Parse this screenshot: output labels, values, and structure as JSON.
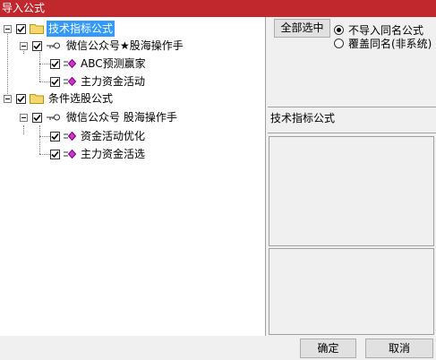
{
  "window": {
    "title": "导入公式"
  },
  "tree": {
    "groups": [
      {
        "label": "技术指标公式",
        "checked": true,
        "selected": true,
        "subgroup": {
          "label": "微信公众号★股海操作手",
          "checked": true,
          "items": [
            {
              "label": "ABC预测赢家",
              "checked": true
            },
            {
              "label": "主力资金活动",
              "checked": true
            }
          ]
        }
      },
      {
        "label": "条件选股公式",
        "checked": true,
        "selected": false,
        "subgroup": {
          "label": "微信公众号 股海操作手",
          "checked": true,
          "items": [
            {
              "label": "资金活动优化",
              "checked": true
            },
            {
              "label": "主力资金活选",
              "checked": true
            }
          ]
        }
      }
    ]
  },
  "options": {
    "select_all_label": "全部选中",
    "radio_skip_label": "不导入同名公式",
    "radio_overwrite_label": "覆盖同名(非系统)",
    "selected_radio": "skip"
  },
  "info": {
    "type_label": "技术指标公式"
  },
  "buttons": {
    "ok_label": "确定",
    "cancel_label": "取消"
  },
  "colors": {
    "titlebar": "#c1282e",
    "selection": "#3399ff",
    "diamond": "#cc33cc",
    "folder": "#f5d76e"
  }
}
